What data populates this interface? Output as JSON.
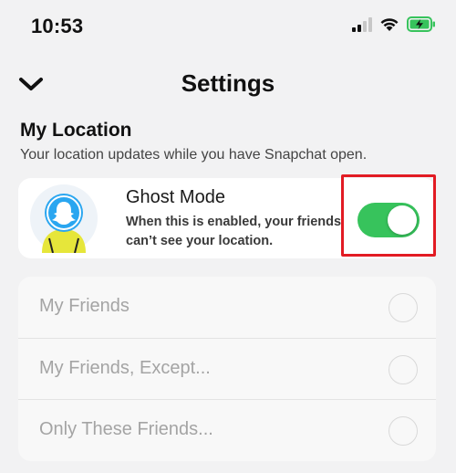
{
  "status_bar": {
    "time": "10:53",
    "icons": [
      "cellular-signal-icon",
      "wifi-icon",
      "battery-charging-icon"
    ]
  },
  "header": {
    "title": "Settings",
    "back_icon": "chevron-down-icon"
  },
  "my_location": {
    "title": "My Location",
    "subtitle": "Your location updates while you have Snapchat open."
  },
  "ghost_mode": {
    "title": "Ghost Mode",
    "description": "When this is enabled, your friends can’t see your location.",
    "enabled": true,
    "toggle_color": "#37c35c"
  },
  "highlight_color": "#e21b23",
  "sharing_options": [
    {
      "label": "My Friends",
      "selected": false
    },
    {
      "label": "My Friends, Except...",
      "selected": false
    },
    {
      "label": "Only These Friends...",
      "selected": false
    }
  ]
}
